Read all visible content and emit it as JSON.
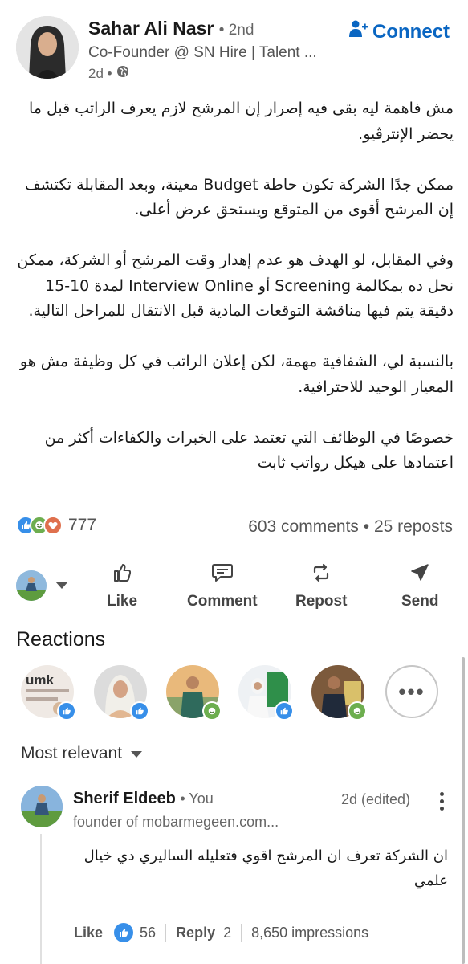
{
  "post": {
    "author": {
      "name": "Sahar Ali Nasr",
      "degree": "• 2nd",
      "headline": "Co-Founder @ SN Hire | Talent ...",
      "time": "2d •",
      "visibility_icon": "globe-icon"
    },
    "connect_label": "Connect",
    "paragraphs": [
      "مش فاهمة ليه بقى فيه إصرار إن المرشح لازم يعرف الراتب قبل ما يحضر الإنترڤيو.",
      "ممكن جدًا الشركة تكون حاطة Budget معينة، وبعد المقابلة تكتشف إن المرشح أقوى من المتوقع ويستحق عرض أعلى.",
      "وفي المقابل، لو الهدف هو عدم إهدار وقت المرشح أو الشركة، ممكن نحل ده بمكالمة Screening أو Interview Online لمدة 10-15 دقيقة يتم فيها مناقشة التوقعات المادية قبل الانتقال للمراحل التالية.",
      "بالنسبة لي، الشفافية مهمة، لكن إعلان الراتب في كل وظيفة مش هو المعيار الوحيد للاحترافية.",
      "خصوصًا في الوظائف التي تعتمد على الخبرات والكفاءات أكثر من اعتمادها على هيكل رواتب ثابت"
    ],
    "reaction_count": "777",
    "comments_reposts": "603 comments • 25 reposts",
    "reaction_icons": [
      "like-icon",
      "support-icon",
      "love-icon"
    ]
  },
  "actions": {
    "like": "Like",
    "comment": "Comment",
    "repost": "Repost",
    "send": "Send"
  },
  "reactions_section": {
    "title": "Reactions",
    "reactors": [
      {
        "icon": "like-badge-icon",
        "avatar_text": "umk"
      },
      {
        "icon": "like-badge-icon",
        "avatar_text": ""
      },
      {
        "icon": "funny-badge-icon",
        "avatar_text": ""
      },
      {
        "icon": "like-badge-icon",
        "avatar_text": ""
      },
      {
        "icon": "funny-badge-icon",
        "avatar_text": ""
      }
    ],
    "more_label": "•••"
  },
  "sort": {
    "label": "Most relevant"
  },
  "comment": {
    "name": "Sherif Eldeeb",
    "you": "• You",
    "headline": "founder of mobarmegeen.com...",
    "time": "2d (edited)",
    "text": "ان الشركة تعرف ان المرشح اقوي فتعليله الساليري دي خيال علمي",
    "like_label": "Like",
    "like_count": "56",
    "reply_label": "Reply",
    "reply_count": "2",
    "impressions": "8,650 impressions"
  },
  "colors": {
    "brand_blue": "#0a66c2",
    "like_blue": "#378fe9",
    "support_green": "#44712e",
    "love_red": "#df704d",
    "text_primary": "#191919",
    "text_secondary": "#666666"
  }
}
